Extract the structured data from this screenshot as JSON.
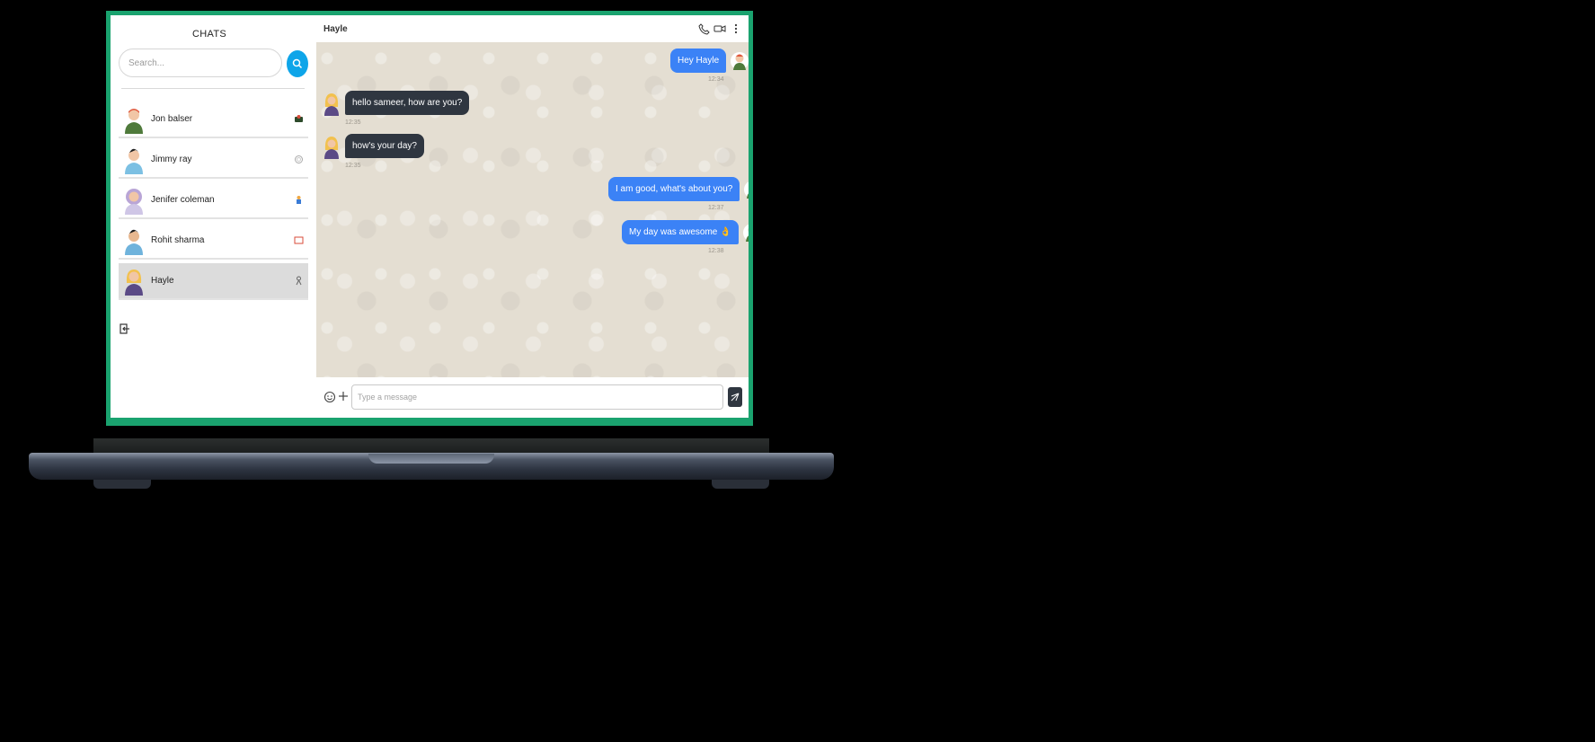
{
  "sidebar": {
    "title": "CHATS",
    "search_placeholder": "Search...",
    "contacts": [
      {
        "name": "Jon balser",
        "active": false
      },
      {
        "name": "Jimmy ray",
        "active": false
      },
      {
        "name": "Jenifer coleman",
        "active": false
      },
      {
        "name": "Rohit sharma",
        "active": false
      },
      {
        "name": "Hayle",
        "active": true
      }
    ]
  },
  "chat": {
    "contact_name": "Hayle",
    "messages": [
      {
        "text": "Hey Hayle",
        "direction": "out",
        "time": "12:34"
      },
      {
        "text": "hello sameer, how are you?",
        "direction": "in",
        "time": "12:35"
      },
      {
        "text": "how's your day?",
        "direction": "in",
        "time": "12:35"
      },
      {
        "text": "I am good, what's about you?",
        "direction": "out",
        "time": "12:37"
      },
      {
        "text": "My day was awesome 👌",
        "direction": "out",
        "time": "12:38"
      }
    ],
    "composer_placeholder": "Type a message"
  },
  "colors": {
    "accent": "#0ea5e9",
    "outgoing_bubble": "#3b82f6",
    "incoming_bubble": "#2f3640",
    "screen_border": "#1aa36f"
  },
  "icons": [
    "search-icon",
    "phone-icon",
    "video-icon",
    "more-vertical-icon",
    "logout-icon",
    "emoji-icon",
    "plus-icon",
    "send-icon"
  ]
}
